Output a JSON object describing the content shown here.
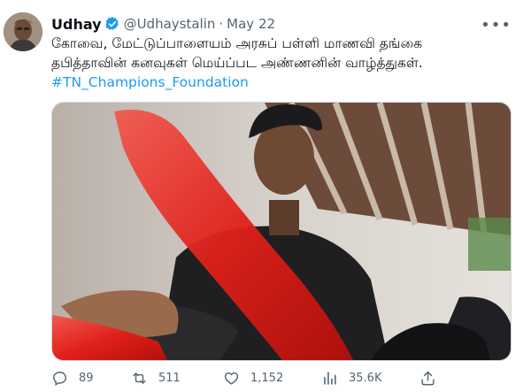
{
  "tweet": {
    "author_name": "Udhay",
    "handle": "@Udhaystalin",
    "separator": "·",
    "date": "May 22",
    "more_label": "•••",
    "text_line1": "கோவை, மேட்டுப்பாளையம் அரசுப் பள்ளி மாணவி தங்கை",
    "text_line2": "தபித்தாவின் கனவுகள் மெய்ப்பட அண்ணனின் வாழ்த்துகள்.",
    "hashtag": "#TN_Champions_Foundation"
  },
  "actions": {
    "replies": "89",
    "retweets": "511",
    "likes": "1,152",
    "views": "35.6K"
  },
  "colors": {
    "link": "#1d9bf0",
    "secondary_text": "#536471",
    "verified_badge": "#1d9bf0"
  }
}
